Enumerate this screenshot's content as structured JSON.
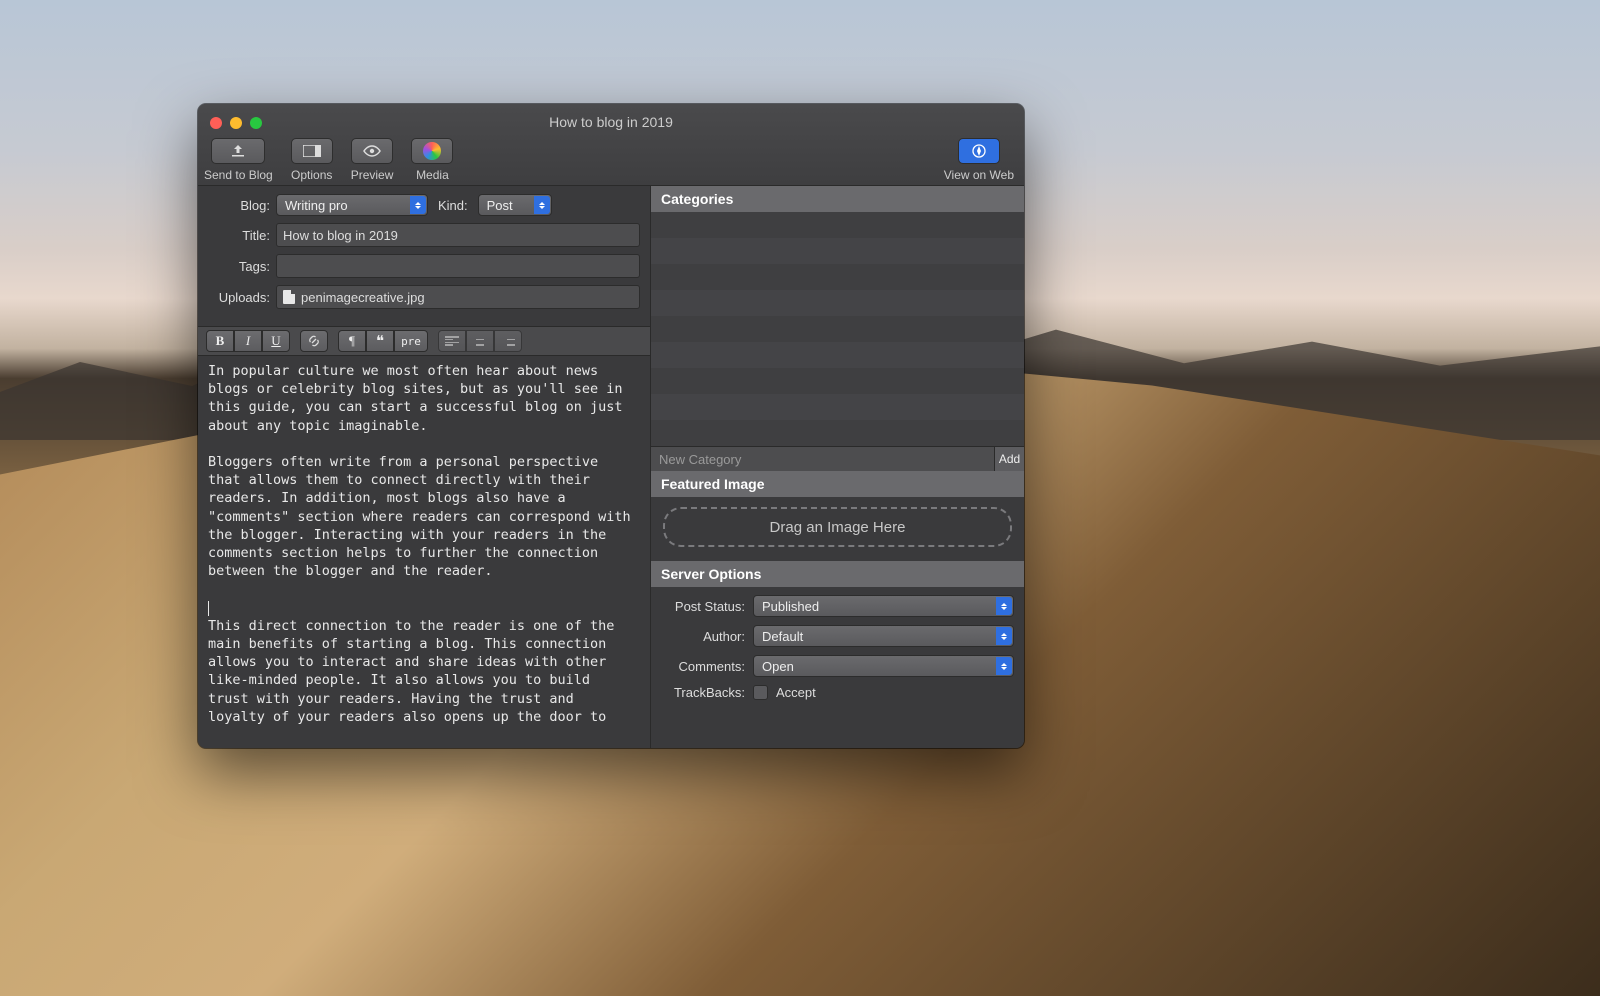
{
  "window": {
    "title": "How to blog in 2019"
  },
  "toolbar": {
    "send": "Send to Blog",
    "options": "Options",
    "preview": "Preview",
    "media": "Media",
    "view_web": "View on Web"
  },
  "form": {
    "blog_label": "Blog:",
    "blog_value": "Writing pro",
    "kind_label": "Kind:",
    "kind_value": "Post",
    "title_label": "Title:",
    "title_value": "How to blog in 2019",
    "tags_label": "Tags:",
    "tags_value": "",
    "uploads_label": "Uploads:",
    "uploads_file": "penimagecreative.jpg"
  },
  "format": {
    "pre": "pre"
  },
  "editor": {
    "body": "In popular culture we most often hear about news blogs or celebrity blog sites, but as you'll see in this guide, you can start a successful blog on just about any topic imaginable.\n\nBloggers often write from a personal perspective that allows them to connect directly with their readers. In addition, most blogs also have a \"comments\" section where readers can correspond with the blogger. Interacting with your readers in the comments section helps to further the connection between the blogger and the reader.\n\n",
    "body2": "\nThis direct connection to the reader is one of the main benefits of starting a blog. This connection allows you to interact and share ideas with other like-minded people. It also allows you to build trust with your readers. Having the trust and loyalty of your readers also opens up the door to"
  },
  "sidebar": {
    "categories_header": "Categories",
    "new_category_placeholder": "New Category",
    "add_label": "Add",
    "featured_header": "Featured Image",
    "drop_label": "Drag an Image Here",
    "server_header": "Server Options",
    "post_status_label": "Post Status:",
    "post_status_value": "Published",
    "author_label": "Author:",
    "author_value": "Default",
    "comments_label": "Comments:",
    "comments_value": "Open",
    "trackbacks_label": "TrackBacks:",
    "trackbacks_accept": "Accept"
  }
}
